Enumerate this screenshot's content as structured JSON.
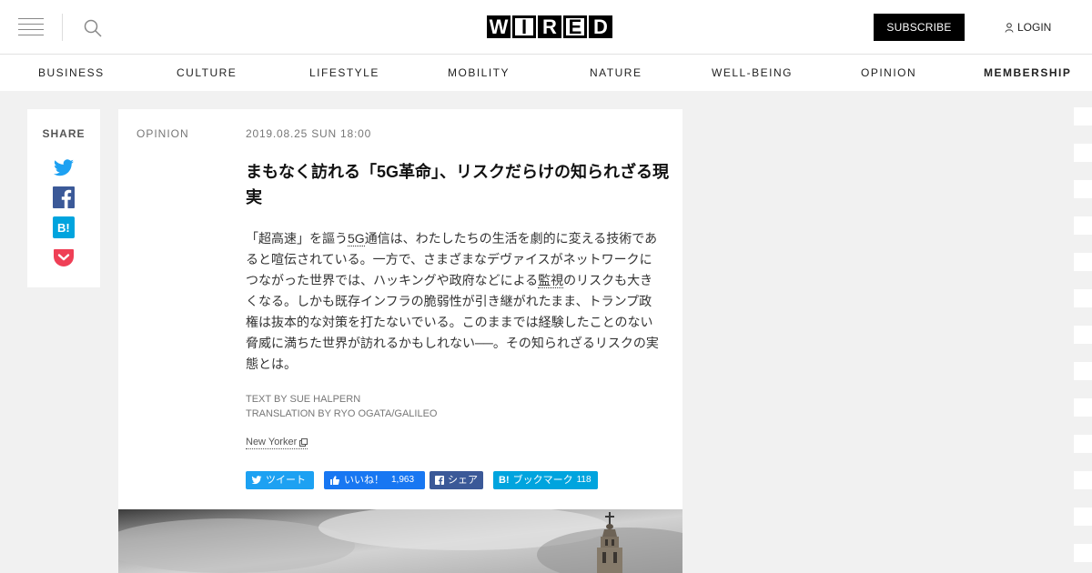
{
  "header": {
    "logo_letters": [
      "W",
      "I",
      "R",
      "E",
      "D"
    ],
    "subscribe_label": "SUBSCRIBE",
    "login_label": "LOGIN"
  },
  "nav": {
    "items": [
      "BUSINESS",
      "CULTURE",
      "LIFESTYLE",
      "MOBILITY",
      "NATURE",
      "WELL-BEING",
      "OPINION",
      "MEMBERSHIP"
    ]
  },
  "share": {
    "title": "SHARE",
    "icons": [
      "twitter-icon",
      "facebook-icon",
      "hatena-bookmark-icon",
      "pocket-icon"
    ]
  },
  "article": {
    "category": "OPINION",
    "date": "2019.08.25 SUN 18:00",
    "headline": "まもなく訪れる「5G革命」、リスクだらけの知られざる現実",
    "lead": {
      "p1": "「超高速」を謳う",
      "link1": "5G",
      "p2": "通信は、わたしたちの生活を劇的に変える技術であると喧伝されている。一方で、さまざまなデヴァイスがネットワークにつながった世界では、ハッキングや政府などによる",
      "link2": "監視",
      "p3": "のリスクも大きくなる。しかも既存インフラの脆弱性が引き継がれたまま、トランプ政権は抜本的な対策を打たないでいる。このままでは経験したことのない脅威に満ちた世界が訪れるかもしれない──。その知られざるリスクの実態とは。"
    },
    "credit_text": "TEXT BY SUE HALPERN",
    "credit_translation": "TRANSLATION BY RYO OGATA/GALILEO",
    "source": "New Yorker"
  },
  "social_buttons": {
    "tweet": {
      "label": "ツイート",
      "color": "#1da1f2"
    },
    "like": {
      "label": "いいね！",
      "count": "1,963",
      "color": "#1877f2"
    },
    "share": {
      "label": "シェア",
      "color": "#3b5998"
    },
    "hatena": {
      "label": "ブックマーク",
      "count": "118",
      "color": "#00a4de"
    }
  },
  "colors": {
    "page_bg": "#f1f1f1",
    "card_bg": "#ffffff",
    "subscribe_bg": "#000000",
    "pocket": "#ef3f56",
    "twitter": "#1da1f2",
    "facebook": "#3b5998",
    "hatena": "#00a4de"
  }
}
